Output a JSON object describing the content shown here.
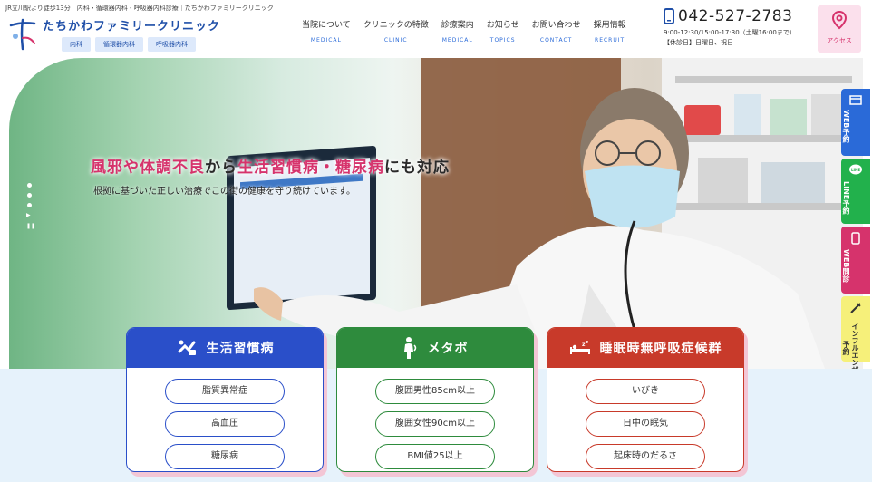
{
  "header": {
    "tagline": "JR立川駅より徒歩13分　内科・循環器内科・呼吸器内科診療｜たちかわファミリークリニック",
    "clinic_name": "たちかわファミリークリニック",
    "dept_tags": [
      "内科",
      "循環器内科",
      "呼吸器内科"
    ],
    "nav": [
      {
        "jp": "当院について",
        "en": "MEDICAL"
      },
      {
        "jp": "クリニックの特徴",
        "en": "CLINIC"
      },
      {
        "jp": "診療案内",
        "en": "MEDICAL"
      },
      {
        "jp": "お知らせ",
        "en": "TOPICS"
      },
      {
        "jp": "お問い合わせ",
        "en": "CONTACT"
      },
      {
        "jp": "採用情報",
        "en": "RECRUIT"
      }
    ],
    "phone": "042-527-2783",
    "hours": "9:00-12:30/15:00-17:30（土曜16:00まで）",
    "closed_days": "【休診日】日曜日、祝日",
    "access_label": "アクセス"
  },
  "hero": {
    "headline_part1": "風邪",
    "headline_part2": "や体調不良",
    "headline_part3": "から",
    "headline_part4": "生活習慣病・糖尿病",
    "headline_part5": "にも対応",
    "subtext": "根拠に基づいた正しい治療でこの街の健康を守り続けています。"
  },
  "side_buttons": [
    {
      "label": "WEB予約",
      "color": "#2a6ad8",
      "icon": "calendar-icon"
    },
    {
      "label": "LINE予約",
      "color": "#22b14c",
      "icon": "line-icon"
    },
    {
      "label": "WEB問診",
      "color": "#d6336c",
      "icon": "smartphone-icon"
    },
    {
      "label": "インフルエンザ予約",
      "color": "#f6f07a",
      "icon": "syringe-icon"
    }
  ],
  "categories": [
    {
      "title": "生活習慣病",
      "color": "#2a4fc9",
      "icon": "health-icon",
      "items": [
        "脂質異常症",
        "高血圧",
        "糖尿病"
      ]
    },
    {
      "title": "メタボ",
      "color": "#2e8b3d",
      "icon": "body-icon",
      "items": [
        "腹囲男性85cm以上",
        "腹囲女性90cm以上",
        "BMI値25以上"
      ]
    },
    {
      "title": "睡眠時無呼吸症候群",
      "color": "#c83a2a",
      "icon": "sleep-icon",
      "items": [
        "いびき",
        "日中の眠気",
        "起床時のだるさ"
      ]
    }
  ]
}
